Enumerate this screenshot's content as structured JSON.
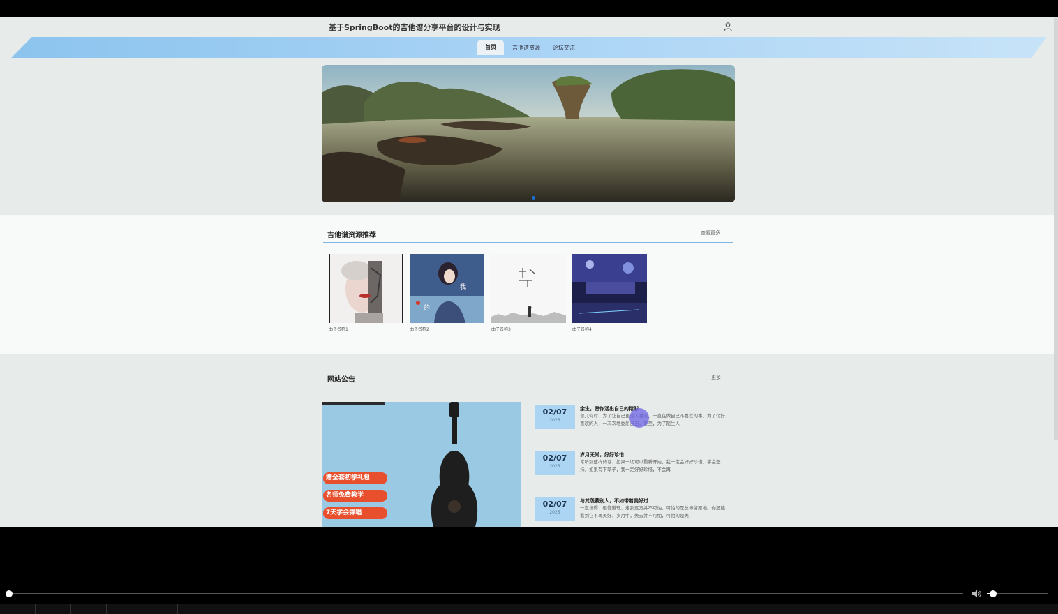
{
  "site": {
    "title": "基于SpringBoot的吉他谱分享平台的设计与实现"
  },
  "nav": {
    "items": [
      {
        "label": "首页",
        "active": true
      },
      {
        "label": "吉他谱资源",
        "active": false
      },
      {
        "label": "论坛交流",
        "active": false
      }
    ]
  },
  "carousel": {
    "image": "landscape with rock islands over calm sea",
    "active_slide": 1
  },
  "recommend": {
    "title": "吉他谱资源推荐",
    "more": "查看更多",
    "items": [
      {
        "caption": "曲子名称1"
      },
      {
        "caption": "曲子名称2"
      },
      {
        "caption": "曲子名称3"
      },
      {
        "caption": "曲子名称4"
      }
    ]
  },
  "notice": {
    "title": "网站公告",
    "more": "更多",
    "promo_badges": [
      "赠全套初学礼包",
      "名师免费教学",
      "7天学会弹唱"
    ],
    "items": [
      {
        "day": "02/07",
        "year": "2025",
        "title": "余生，愿你活出自己的精彩",
        "excerpt": "曾几何时，为了让自己更讨人喜欢，一直在做自己不喜欢的事，为了讨好喜欢的人，一次次地委屈自己，甚至，为了陌生人"
      },
      {
        "day": "02/07",
        "year": "2025",
        "title": "岁月无常，好好珍惜",
        "excerpt": "常听到这样的话：如果一切可以重新开始，我一定会好好珍惜，学会坚持。如果有下辈子，我一定好好珍惜，不会再"
      },
      {
        "day": "02/07",
        "year": "2025",
        "title": "与其羡慕别人，不如带着美好过",
        "excerpt": "一直觉得，很懂道理，走到远方并不可怕，可怕的是总停留原地。你还能看到它不再美好，岁月中，失去并不可怕，可怕的是失"
      }
    ]
  },
  "player": {
    "progress": 0.0,
    "volume": 0.1
  },
  "colors": {
    "nav_band": "#a9d3f5",
    "section_line": "#7fb6e2",
    "date_box": "#abd5f3",
    "promo_badge": "#e8502d"
  }
}
